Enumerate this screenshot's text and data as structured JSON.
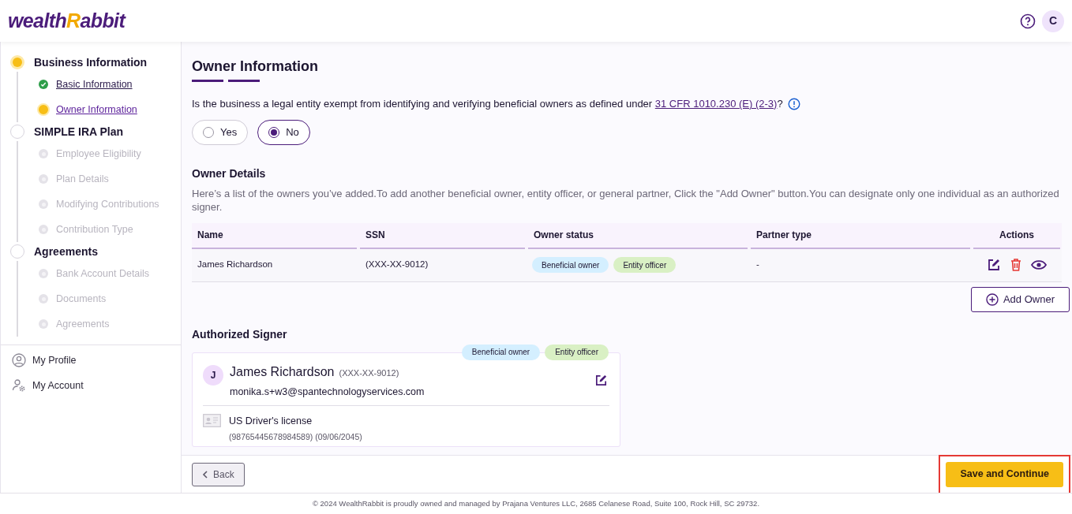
{
  "header": {
    "logo": {
      "lead": "wealth",
      "accent": "R",
      "rest": "abbit"
    },
    "avatar_initial": "C"
  },
  "sidebar": {
    "sections": [
      {
        "label": "Business Information",
        "active": true,
        "children": [
          {
            "label": "Basic Information",
            "completed": true,
            "active": false
          },
          {
            "label": "Owner Information",
            "completed": false,
            "active": true
          }
        ]
      },
      {
        "label": "SIMPLE IRA Plan",
        "active": false,
        "children": [
          {
            "label": "Employee Eligibility",
            "completed": false,
            "active": false
          },
          {
            "label": "Plan Details",
            "completed": false,
            "active": false
          },
          {
            "label": "Modifying Contributions",
            "completed": false,
            "active": false
          },
          {
            "label": "Contribution Type",
            "completed": false,
            "active": false
          }
        ]
      },
      {
        "label": "Agreements",
        "active": false,
        "children": [
          {
            "label": "Bank Account Details",
            "completed": false,
            "active": false
          },
          {
            "label": "Documents",
            "completed": false,
            "active": false
          },
          {
            "label": "Agreements",
            "completed": false,
            "active": false
          }
        ]
      }
    ],
    "links": [
      {
        "label": "My Profile",
        "kind": "profile"
      },
      {
        "label": "My Account",
        "kind": "account"
      }
    ]
  },
  "page_title": "Owner Information",
  "question": {
    "text": "Is the business a legal entity exempt from identifying and verifying beneficial owners as defined under",
    "link": "31 CFR 1010.230 (E) (2-3)",
    "suffix": "?",
    "options": [
      {
        "label": "Yes",
        "selected": false
      },
      {
        "label": "No",
        "selected": true
      }
    ]
  },
  "owner_details": {
    "title": "Owner Details",
    "description": "Here’s a list of the owners you’ve added.To add another beneficial owner, entity officer, or general partner, Click the \"Add Owner\" button.You can designate only one individual as an authorized signer.",
    "table": {
      "columns": [
        "Name",
        "SSN",
        "Owner status",
        "Partner type",
        "Actions"
      ],
      "rows": [
        {
          "name": "James Richardson",
          "ssn": "(XXX-XX-9012)",
          "statuses": [
            {
              "label": "Beneficial owner",
              "color": "#d4efff"
            },
            {
              "label": "Entity officer",
              "color": "#d9f0c4"
            }
          ],
          "partner_type": "-"
        }
      ]
    },
    "add_button": "Add Owner"
  },
  "authorized_signer": {
    "title": "Authorized Signer",
    "tags": [
      {
        "label": "Beneficial owner",
        "color": "#d4efff"
      },
      {
        "label": "Entity officer",
        "color": "#d9f0c4"
      }
    ],
    "initial": "J",
    "name": "James Richardson",
    "ssn": "(XXX-XX-9012)",
    "email": "monika.s+w3@spantechnologyservices.com",
    "id_type": "US Driver's license",
    "id_detail": "(98765445678984589) (09/06/2045)"
  },
  "footer": {
    "back": "Back",
    "save": "Save and Continue",
    "save_highlighted": true,
    "copyright": "© 2024 WealthRabbit is proudly owned and managed by Prajana Ventures LLC, 2685 Celanese Road, Suite 100, Rock Hill, SC 29732."
  }
}
